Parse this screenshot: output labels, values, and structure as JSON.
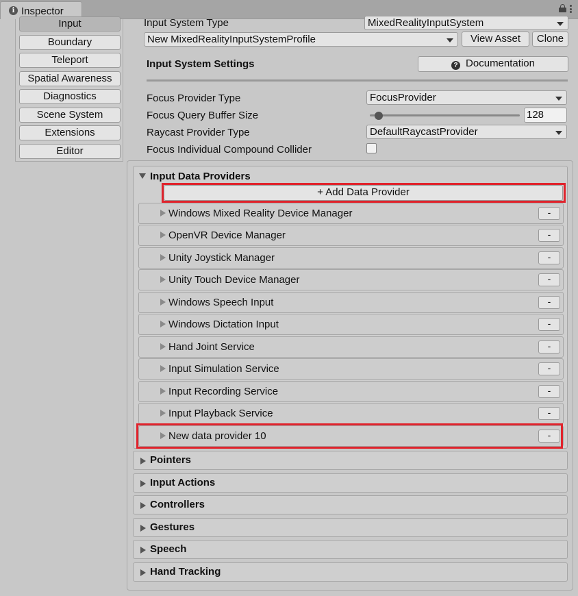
{
  "window": {
    "tab_title": "Inspector"
  },
  "sidebar": {
    "items": [
      {
        "label": "Input",
        "active": true
      },
      {
        "label": "Boundary"
      },
      {
        "label": "Teleport"
      },
      {
        "label": "Spatial Awareness"
      },
      {
        "label": "Diagnostics"
      },
      {
        "label": "Scene System"
      },
      {
        "label": "Extensions"
      },
      {
        "label": "Editor"
      }
    ]
  },
  "main": {
    "input_system_type": {
      "label": "Input System Type",
      "value": "MixedRealityInputSystem"
    },
    "profile": {
      "value": "New MixedRealityInputSystemProfile",
      "view_asset_label": "View Asset",
      "clone_label": "Clone"
    },
    "settings_header": "Input System Settings",
    "documentation_label": "Documentation",
    "focus_provider_type": {
      "label": "Focus Provider Type",
      "value": "FocusProvider"
    },
    "focus_query_buffer_size": {
      "label": "Focus Query Buffer Size",
      "value": "128"
    },
    "raycast_provider_type": {
      "label": "Raycast Provider Type",
      "value": "DefaultRaycastProvider"
    },
    "focus_individual_compound_collider": {
      "label": "Focus Individual Compound Collider",
      "checked": false
    },
    "data_providers": {
      "title": "Input Data Providers",
      "add_label": "+ Add Data Provider",
      "remove_label": "-",
      "items": [
        "Windows Mixed Reality Device Manager",
        "OpenVR Device Manager",
        "Unity Joystick Manager",
        "Unity Touch Device Manager",
        "Windows Speech Input",
        "Windows Dictation Input",
        "Hand Joint Service",
        "Input Simulation Service",
        "Input Recording Service",
        "Input Playback Service",
        "New data provider 10"
      ]
    },
    "sections": [
      "Pointers",
      "Input Actions",
      "Controllers",
      "Gestures",
      "Speech",
      "Hand Tracking"
    ]
  },
  "colors": {
    "highlight": "#e0232c",
    "background": "#c8c8c8",
    "button": "#e4e4e4"
  },
  "icons": [
    "info-icon",
    "lock-icon",
    "menu-icon",
    "help-icon",
    "dropdown-arrow-icon",
    "foldout-icon"
  ]
}
